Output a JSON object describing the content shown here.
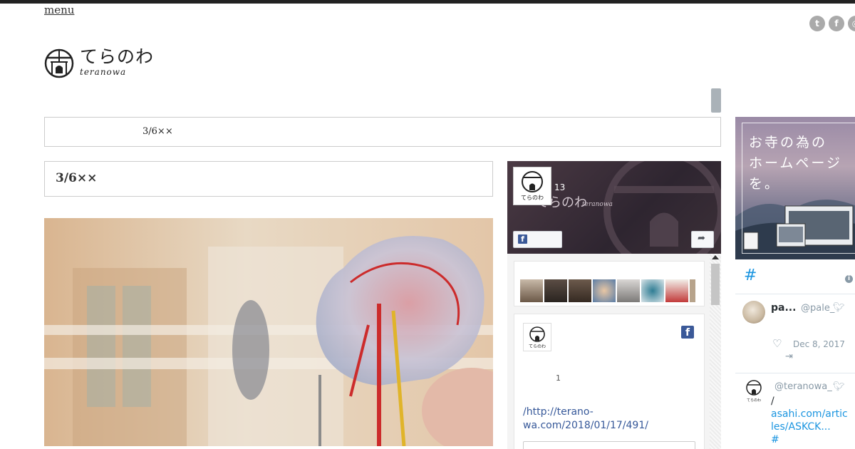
{
  "header": {
    "menu_label": "menu",
    "logo": {
      "jp": "てらのわ",
      "en": "teranowa"
    },
    "social_icons": [
      "twitter-icon",
      "facebook-icon",
      "instagram-icon"
    ]
  },
  "breadcrumb": {
    "text": "3/6××"
  },
  "article": {
    "title": "3/6××"
  },
  "facebook_widget": {
    "page_name": "てらのわ",
    "page_name_en": "teranowa",
    "like_count": "13",
    "post": {
      "count": "1",
      "link_text": "/http://terano-wa.com/2018/01/17/491/"
    }
  },
  "ad_banner": {
    "text": "お寺の為の\nホームページ\nを。"
  },
  "twitter_widget": {
    "hash": "#",
    "tweets": [
      {
        "name": "pa...",
        "handle": "@pale_",
        "date": "Dec 8, 2017"
      },
      {
        "handle": "@teranowa_",
        "body_slash": "/",
        "body_link": "asahi.com/articles/ASKCK...",
        "body_hash": "#"
      }
    ]
  },
  "colors": {
    "accent": "#1b95e0",
    "facebook": "#3b5998",
    "border": "#cccccc"
  }
}
